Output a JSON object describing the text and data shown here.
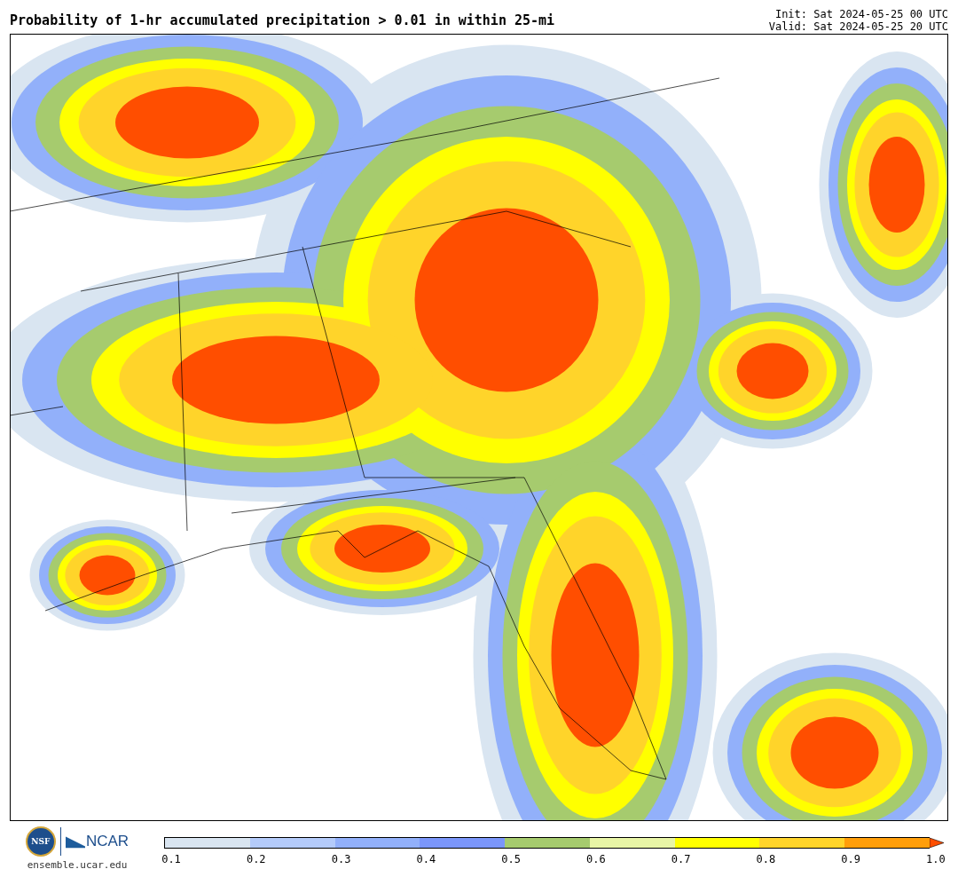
{
  "title": "Probability of 1-hr accumulated precipitation > 0.01 in within 25-mi",
  "init": "Init: Sat 2024-05-25 00 UTC",
  "valid": "Valid: Sat 2024-05-25 20 UTC",
  "logo": {
    "nsf": "NSF",
    "ncar": "NCAR",
    "url": "ensemble.ucar.edu"
  },
  "colorbar": {
    "bins": [
      {
        "color": "#d9e5f1"
      },
      {
        "color": "#b4cbfa"
      },
      {
        "color": "#92b0fa"
      },
      {
        "color": "#7b96fa"
      },
      {
        "color": "#a6cb6e"
      },
      {
        "color": "#e8f5a6"
      },
      {
        "color": "#ffff00"
      },
      {
        "color": "#ffd42a"
      },
      {
        "color": "#ff9e0a"
      }
    ],
    "extend": {
      "kind": "arrow",
      "color": "#ff4e00"
    },
    "ticks": [
      "0.1",
      "0.2",
      "0.3",
      "0.4",
      "0.5",
      "0.6",
      "0.7",
      "0.8",
      "0.9",
      "1.0"
    ]
  }
}
